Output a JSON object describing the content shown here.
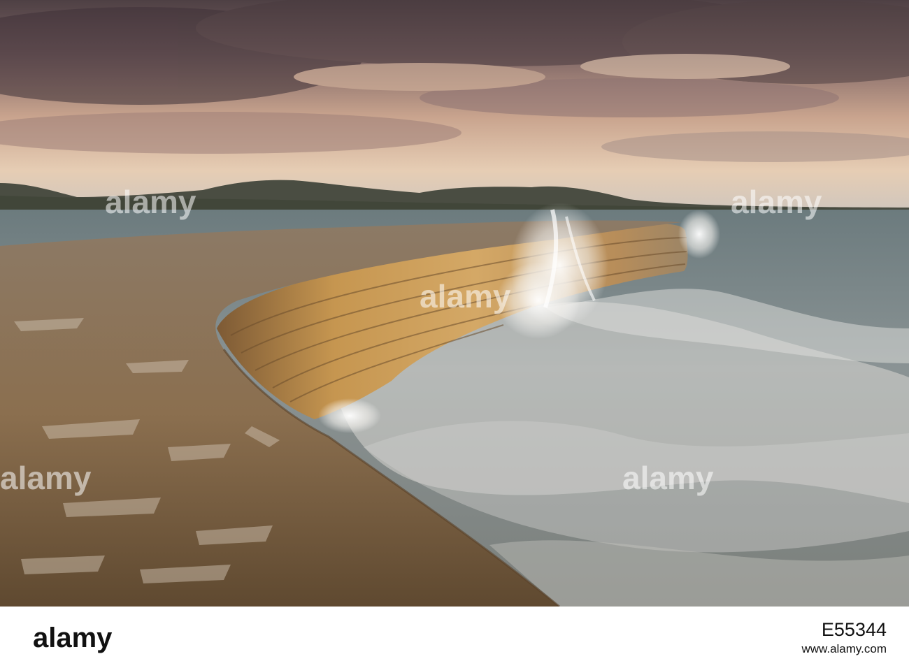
{
  "colors": {
    "sky_top": "#5e4e4e",
    "sky_glow": "#e9c9a9",
    "sea": "#7f8a8b",
    "wall_lit": "#c7974f",
    "walkway": "#8b7252",
    "footer_bg": "#ffffff"
  },
  "photo": {
    "watermark": "alamy"
  },
  "footer": {
    "logo_text": "alamy",
    "image_id": "E55344",
    "site": "www.alamy.com"
  }
}
